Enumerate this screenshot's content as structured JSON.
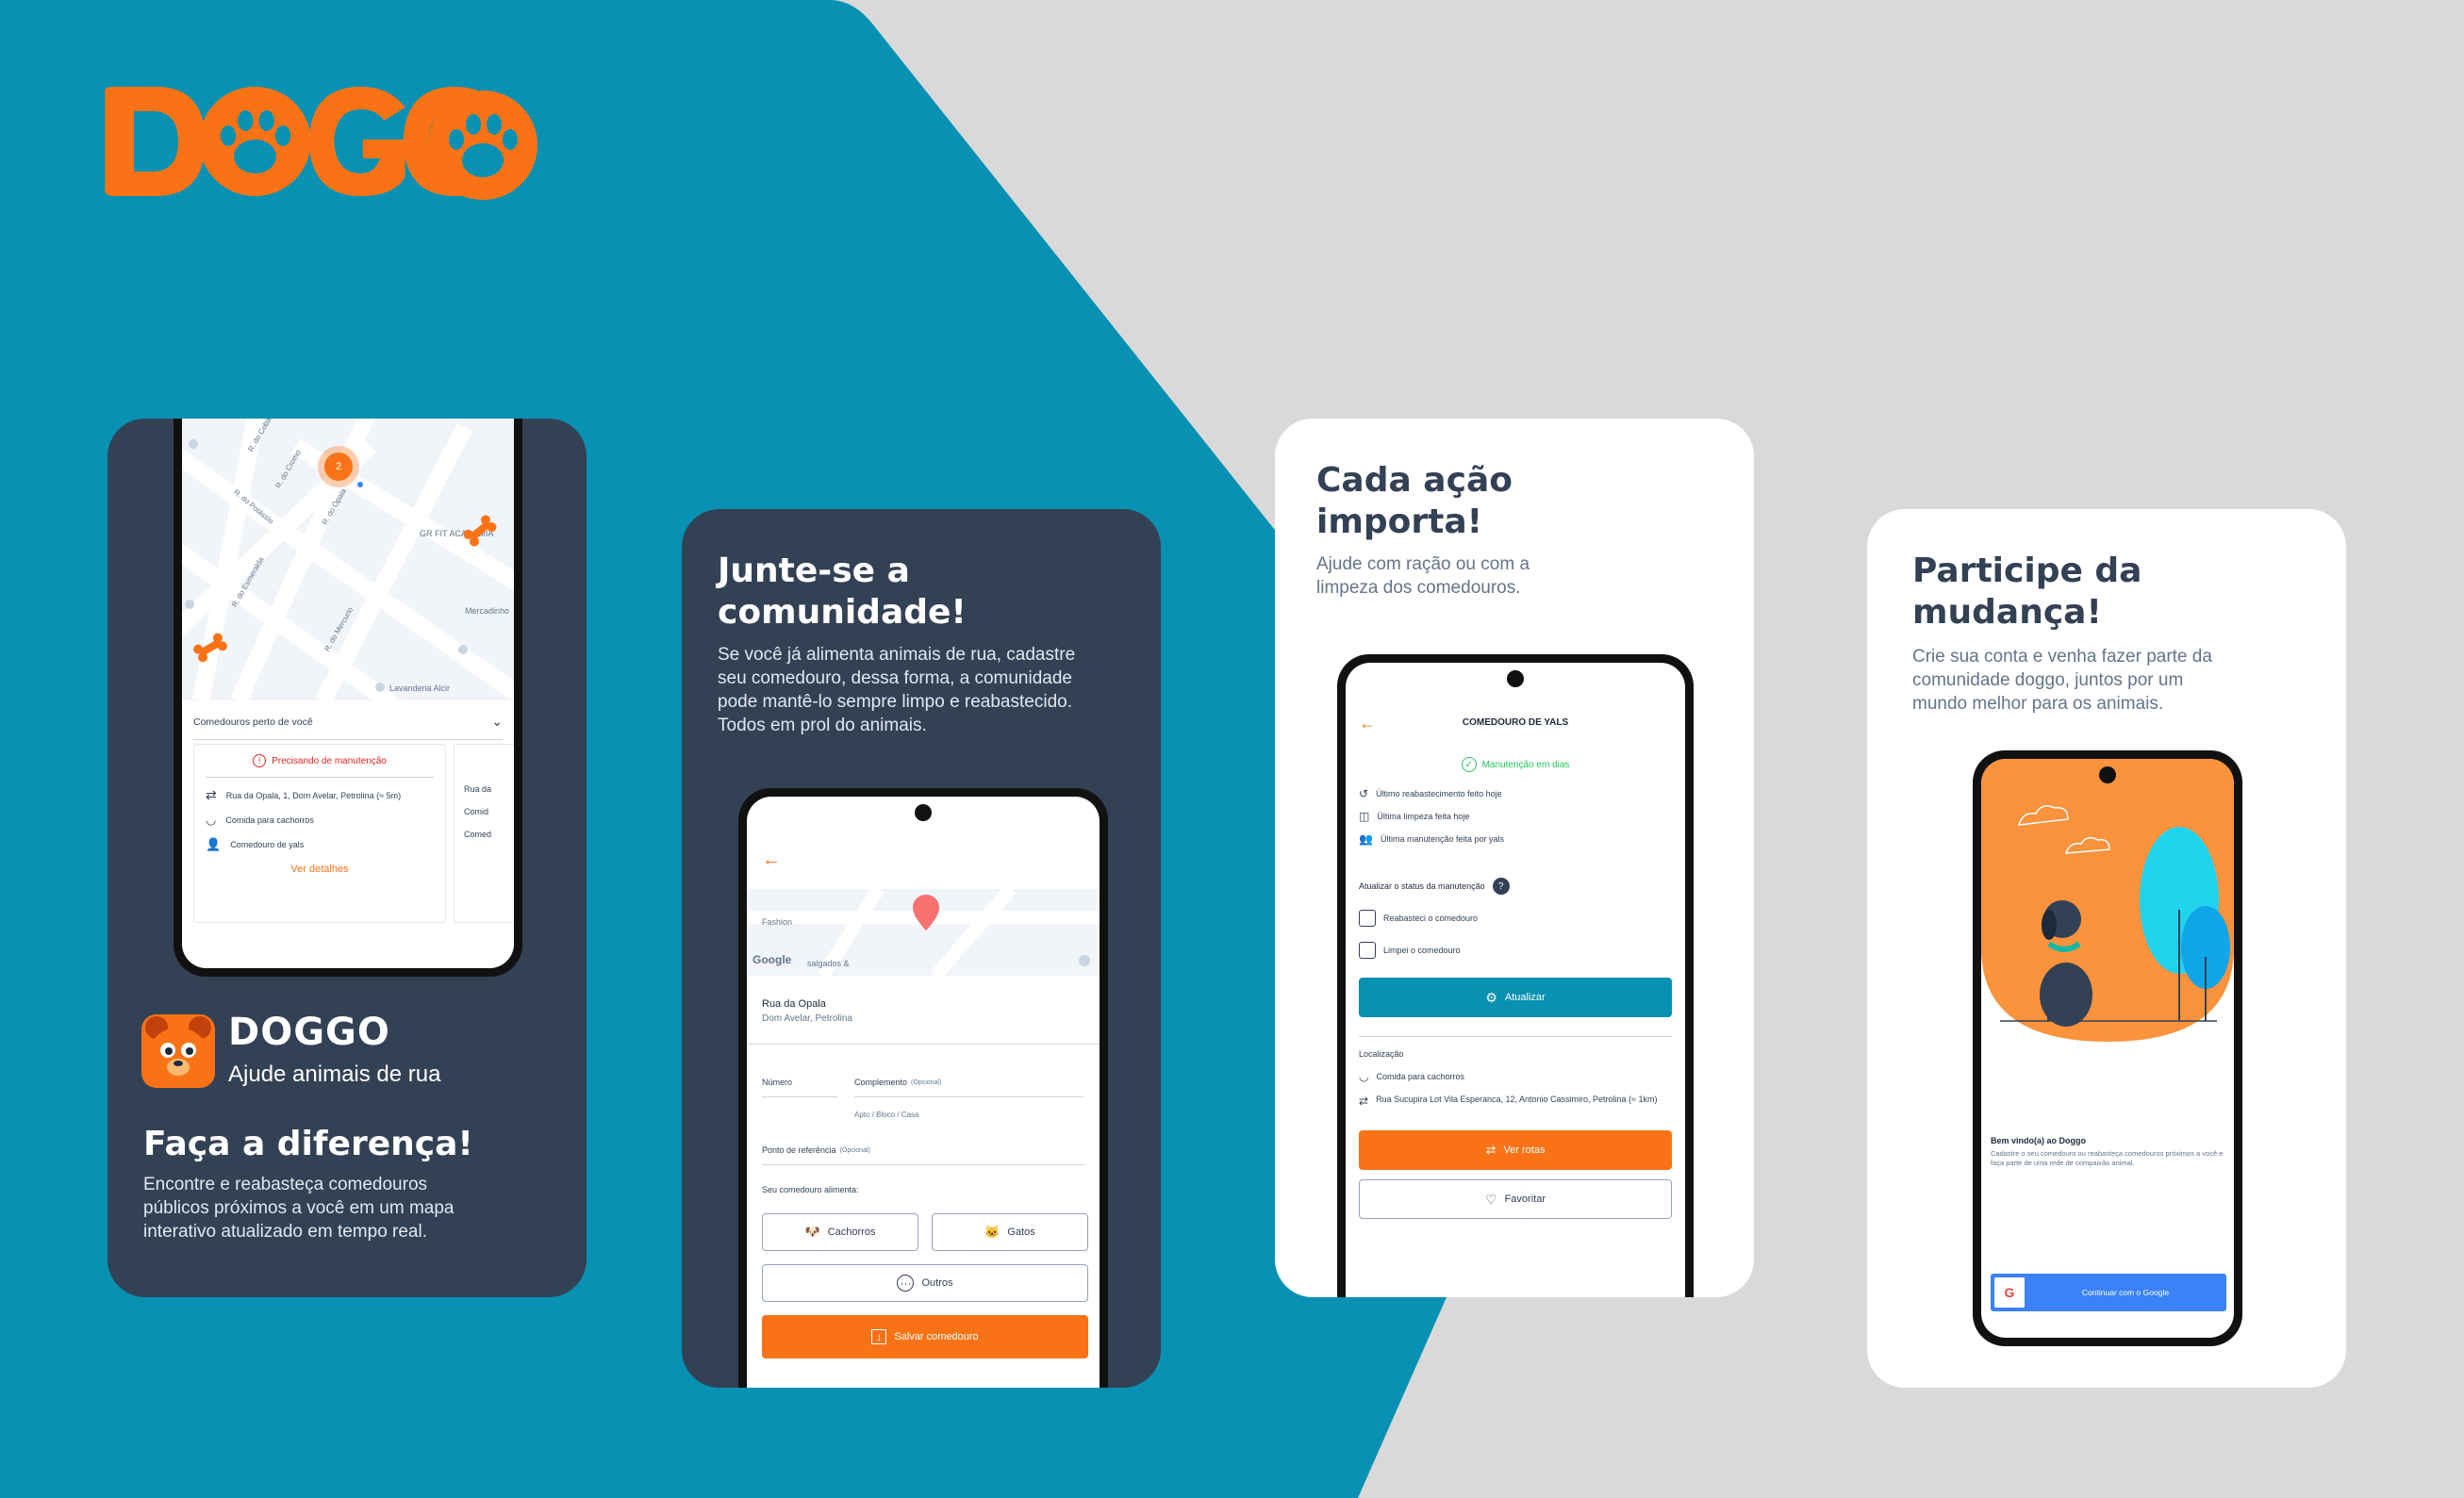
{
  "brand": {
    "logo_text": "DOGGO",
    "tagline": "Ajude animais de rua"
  },
  "colors": {
    "teal": "#0891b2",
    "orange": "#f97316",
    "navy": "#334155",
    "gray_bg": "#d9d9d9"
  },
  "card1": {
    "headline": "Faça a diferença!",
    "description": "Encontre e reabasteça comedouros públicos próximos a você em um mapa interativo atualizado em tempo real.",
    "map": {
      "streets": [
        "R. do Cobalto",
        "R. do Cromo",
        "R. do Potássio",
        "R. do Cromo",
        "R. do Ópala",
        "R. do Feldto",
        "R. do Esmeralda",
        "R. do Basalto",
        "R. do Opala",
        "R. do Mercurio",
        "R. do Basalto"
      ],
      "places": [
        "GR FIT ACADEMIA",
        "Mercadinho",
        "Lavanderia Alcir"
      ],
      "cluster_count": "2"
    },
    "sheet_title": "Comedouros perto de você",
    "feeder": {
      "status": "Precisando de manutenção",
      "address": "Rua da Opala, 1, Dom Avelar, Petrolina (≈ 5m)",
      "food": "Comida para cachorros",
      "owner": "Comedouro de yals",
      "details_button": "Ver detalhes"
    },
    "feeder2_partial": {
      "address": "Rua da",
      "food": "Comid",
      "owner": "Comed"
    }
  },
  "card2": {
    "headline": "Junte-se a comunidade!",
    "description": "Se você já alimenta animais de rua, cadastre seu comedouro, dessa forma, a comunidade pode mantê-lo sempre limpo e reabastecido. Todos em prol do animais.",
    "map_labels": [
      "Fashion",
      "salgados &",
      "Google"
    ],
    "address_line1": "Rua da Opala",
    "address_line2": "Dom Avelar, Petrolina",
    "numero_label": "Número",
    "complemento_label": "Complemento",
    "opcional": "(Opcional)",
    "complemento_placeholder": "Apto / Bloco / Casa",
    "referencia_label": "Ponto de referência",
    "feeds_label": "Seu comedouro alimenta:",
    "option_dogs": "Cachorros",
    "option_cats": "Gatos",
    "option_others": "Outros",
    "save_button": "Salvar comedouro"
  },
  "card3": {
    "headline": "Cada ação importa!",
    "description": "Ajude com ração ou com a limpeza dos comedouros.",
    "screen_title": "COMEDOURO DE YALS",
    "status": "Manutenção em dias",
    "history": [
      "Último reabastecimento feito hoje",
      "Última limpeza feita hoje",
      "Última manutenção feita por yals"
    ],
    "update_label": "Atualizar o status da manutenção",
    "checks": [
      "Reabasteci o comedouro",
      "Limpei o comedouro"
    ],
    "update_button": "Atualizar",
    "location_label": "Localização",
    "food": "Comida para cachorros",
    "address": "Rua Sucupira Lot Vila Esperanca, 12, Antonio Cassimiro, Petrolina (≈ 1km)",
    "routes_button": "Ver rotas",
    "favorite_button": "Favoritar"
  },
  "card4": {
    "headline": "Participe da mudança!",
    "description": "Crie sua conta e venha fazer parte da comunidade doggo, juntos por um mundo melhor para os animais.",
    "welcome_title": "Bem vindo(a) ao Doggo",
    "welcome_text": "Cadastre o seu comedouro ou reabasteça comedouros próximos a você e faça parte de uma rede de compaixão animal.",
    "google_button": "Continuar com o Google"
  }
}
